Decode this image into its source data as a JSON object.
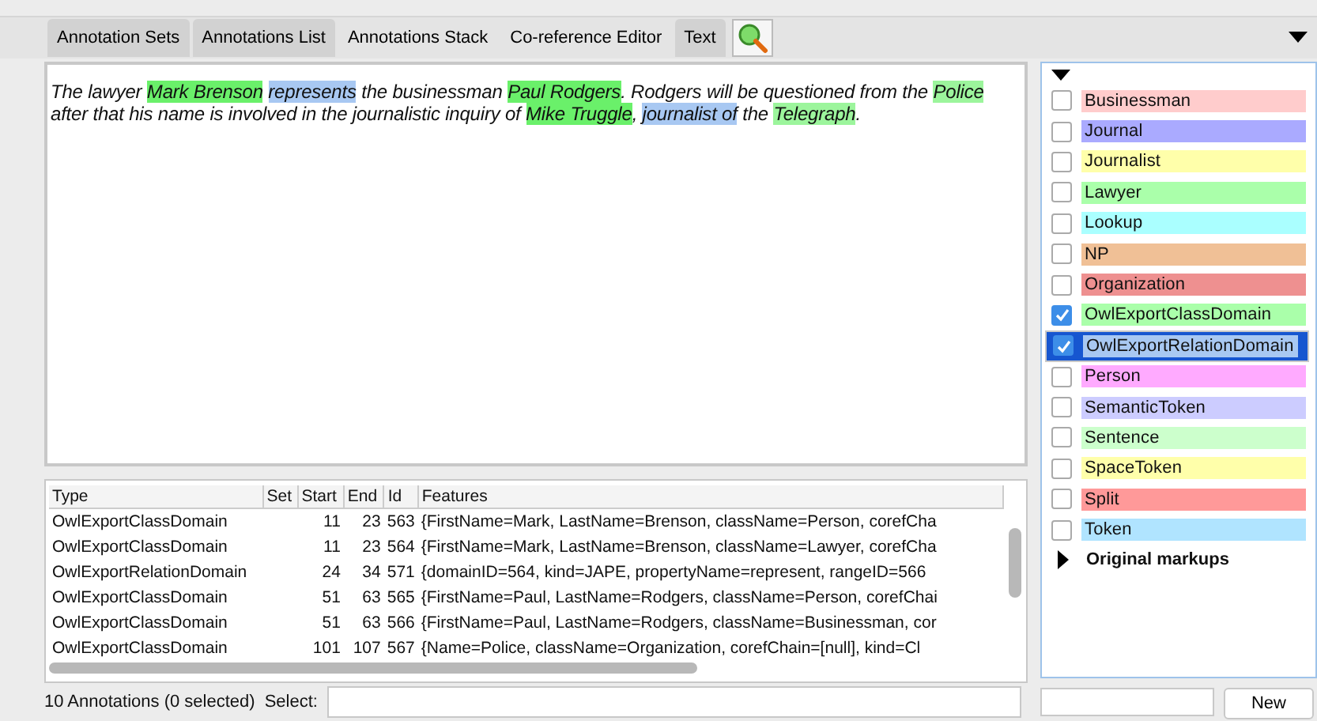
{
  "tabs": [
    {
      "label": "Annotation Sets",
      "selected": true
    },
    {
      "label": "Annotations List",
      "selected": true
    },
    {
      "label": "Annotations Stack",
      "selected": false
    },
    {
      "label": "Co-reference Editor",
      "selected": false
    },
    {
      "label": "Text",
      "selected": true
    }
  ],
  "document": {
    "segments": [
      {
        "text": "The lawyer "
      },
      {
        "text": "Mark Brenson",
        "color": "#6af06a"
      },
      {
        "text": "represents",
        "color": "#a8c8f2",
        "space_before": true
      },
      {
        "text": " the businessman "
      },
      {
        "text": "Paul Rodgers",
        "color": "#6af06a"
      },
      {
        "text": ". Rodgers will be questioned from the "
      },
      {
        "text": "Police",
        "color": "#9cf59c"
      },
      {
        "text": " after that his name is involved in the journalistic inquiry of "
      },
      {
        "text": "Mike Truggle",
        "color": "#6af06a"
      },
      {
        "text": ", "
      },
      {
        "text": "journalist of",
        "color": "#a8c8f2"
      },
      {
        "text": " the "
      },
      {
        "text": "Telegraph",
        "color": "#9cf59c"
      },
      {
        "text": "."
      }
    ]
  },
  "table": {
    "columns": [
      "Type",
      "Set",
      "Start",
      "End",
      "Id",
      "Features"
    ],
    "rows": [
      [
        "OwlExportClassDomain",
        "",
        "11",
        "23",
        "563",
        "{FirstName=Mark, LastName=Brenson, className=Person, corefCha"
      ],
      [
        "OwlExportClassDomain",
        "",
        "11",
        "23",
        "564",
        "{FirstName=Mark, LastName=Brenson, className=Lawyer, corefCha"
      ],
      [
        "OwlExportRelationDomain",
        "",
        "24",
        "34",
        "571",
        "{domainID=564, kind=JAPE, propertyName=represent, rangeID=566"
      ],
      [
        "OwlExportClassDomain",
        "",
        "51",
        "63",
        "565",
        "{FirstName=Paul, LastName=Rodgers, className=Person, corefChai"
      ],
      [
        "OwlExportClassDomain",
        "",
        "51",
        "63",
        "566",
        "{FirstName=Paul, LastName=Rodgers, className=Businessman, cor"
      ],
      [
        "OwlExportClassDomain",
        "",
        "101",
        "107",
        "567",
        "{Name=Police, className=Organization, corefChain=[null], kind=Cl"
      ]
    ]
  },
  "status": {
    "count": "10 Annotations (0 selected)",
    "select_label": "Select:"
  },
  "annotation_types": [
    {
      "name": "Businessman",
      "color": "#ffcccc",
      "checked": false,
      "selected": false
    },
    {
      "name": "Journal",
      "color": "#aaaaff",
      "checked": false,
      "selected": false
    },
    {
      "name": "Journalist",
      "color": "#ffffaa",
      "checked": false,
      "selected": false
    },
    {
      "name": "Lawyer",
      "color": "#aaffaa",
      "checked": false,
      "selected": false
    },
    {
      "name": "Lookup",
      "color": "#aaffff",
      "checked": false,
      "selected": false
    },
    {
      "name": "NP",
      "color": "#f0c096",
      "checked": false,
      "selected": false
    },
    {
      "name": "Organization",
      "color": "#ee9090",
      "checked": false,
      "selected": false
    },
    {
      "name": "OwlExportClassDomain",
      "color": "#aaffaa",
      "checked": true,
      "selected": false
    },
    {
      "name": "OwlExportRelationDomain",
      "color": "#a8c8f2",
      "checked": true,
      "selected": true
    },
    {
      "name": "Person",
      "color": "#ffaaff",
      "checked": false,
      "selected": false
    },
    {
      "name": "SemanticToken",
      "color": "#ccccff",
      "checked": false,
      "selected": false
    },
    {
      "name": "Sentence",
      "color": "#ccffcc",
      "checked": false,
      "selected": false
    },
    {
      "name": "SpaceToken",
      "color": "#ffffaa",
      "checked": false,
      "selected": false
    },
    {
      "name": "Split",
      "color": "#ff9999",
      "checked": false,
      "selected": false
    },
    {
      "name": "Token",
      "color": "#b0e4ff",
      "checked": false,
      "selected": false
    }
  ],
  "markup_group": {
    "label": "Original markups",
    "expanded": false
  },
  "new_button": "New"
}
